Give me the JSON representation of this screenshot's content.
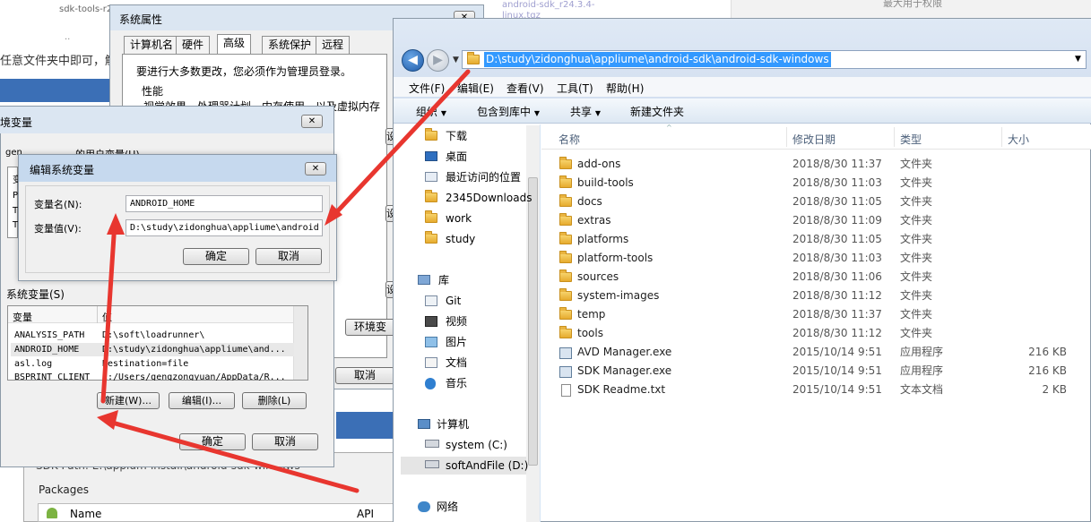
{
  "background": {
    "top_link_left": "sdk-tools-r24",
    "top_link_center": "android-sdk_r24.3.4-linux.tgz",
    "left_snippet": "任意文件夹中即可，解",
    "ellipsis": "..",
    "right_top_text": "最大用于权限",
    "sdk_path_label": "SDK Path: E:\\appium-install\\android-sdk-windows",
    "packages_label": "Packages",
    "col_name": "Name",
    "col_api": "API"
  },
  "system_properties": {
    "title": "系统属性",
    "tabs": [
      "计算机名",
      "硬件",
      "高级",
      "系统保护",
      "远程"
    ],
    "active_tab": "高级",
    "admin_note": "要进行大多数更改，您必须作为管理员登录。",
    "perf_group": "性能",
    "perf_desc": "视觉效果，处理器计划，内存使用，以及虚拟内存",
    "settings_btn": "设",
    "env_btn": "环境变",
    "cancel_btn": "取消"
  },
  "env_vars": {
    "title": "环境变量",
    "user_label_prefix": "gen",
    "user_label": "的用户变量(U)",
    "sys_label": "系统变量(S)",
    "col_var": "变量",
    "col_value": "值",
    "rows": [
      {
        "name": "ANALYSIS_PATH",
        "value": "D:\\soft\\loadrunner\\"
      },
      {
        "name": "ANDROID_HOME",
        "value": "D:\\study\\zidonghua\\appliume\\and..."
      },
      {
        "name": "asl.log",
        "value": "Destination=file"
      },
      {
        "name": "BSPRINT_CLIENT",
        "value": "C:/Users/gengzongyuan/AppData/R..."
      }
    ],
    "new_btn": "新建(W)...",
    "edit_btn": "编辑(I)...",
    "delete_btn": "删除(L)",
    "ok_btn": "确定",
    "cancel_btn": "取消",
    "user_list_initials": [
      "P",
      "T",
      "T"
    ],
    "user_list_header": "变"
  },
  "edit_var": {
    "title": "编辑系统变量",
    "name_label": "变量名(N):",
    "name_value": "ANDROID_HOME",
    "value_label": "变量值(V):",
    "value_value": "D:\\study\\zidonghua\\appliume\\android",
    "ok_btn": "确定",
    "cancel_btn": "取消"
  },
  "explorer": {
    "address": "D:\\study\\zidonghua\\appliume\\android-sdk\\android-sdk-windows",
    "menu": [
      "文件(F)",
      "编辑(E)",
      "查看(V)",
      "工具(T)",
      "帮助(H)"
    ],
    "toolbar": [
      "组织",
      "包含到库中",
      "共享",
      "新建文件夹"
    ],
    "columns": {
      "name": "名称",
      "date": "修改日期",
      "type": "类型",
      "size": "大小"
    },
    "nav": [
      {
        "label": "下载",
        "icon": "download-folder-icon"
      },
      {
        "label": "桌面",
        "icon": "desktop-icon"
      },
      {
        "label": "最近访问的位置",
        "icon": "recent-places-icon"
      },
      {
        "label": "2345Downloads",
        "icon": "folder-icon"
      },
      {
        "label": "work",
        "icon": "folder-icon"
      },
      {
        "label": "study",
        "icon": "folder-icon"
      },
      {
        "label": "库",
        "icon": "library-icon"
      },
      {
        "label": "Git",
        "icon": "git-library-icon"
      },
      {
        "label": "视频",
        "icon": "video-library-icon"
      },
      {
        "label": "图片",
        "icon": "picture-library-icon"
      },
      {
        "label": "文档",
        "icon": "document-library-icon"
      },
      {
        "label": "音乐",
        "icon": "music-library-icon"
      },
      {
        "label": "计算机",
        "icon": "computer-icon"
      },
      {
        "label": "system (C:)",
        "icon": "drive-icon"
      },
      {
        "label": "softAndFile (D:)",
        "icon": "drive-icon"
      },
      {
        "label": "网络",
        "icon": "network-icon"
      }
    ],
    "files": [
      {
        "name": "add-ons",
        "date": "2018/8/30 11:37",
        "type": "文件夹",
        "size": "",
        "kind": "folder"
      },
      {
        "name": "build-tools",
        "date": "2018/8/30 11:03",
        "type": "文件夹",
        "size": "",
        "kind": "folder"
      },
      {
        "name": "docs",
        "date": "2018/8/30 11:05",
        "type": "文件夹",
        "size": "",
        "kind": "folder"
      },
      {
        "name": "extras",
        "date": "2018/8/30 11:09",
        "type": "文件夹",
        "size": "",
        "kind": "folder"
      },
      {
        "name": "platforms",
        "date": "2018/8/30 11:05",
        "type": "文件夹",
        "size": "",
        "kind": "folder"
      },
      {
        "name": "platform-tools",
        "date": "2018/8/30 11:03",
        "type": "文件夹",
        "size": "",
        "kind": "folder"
      },
      {
        "name": "sources",
        "date": "2018/8/30 11:06",
        "type": "文件夹",
        "size": "",
        "kind": "folder"
      },
      {
        "name": "system-images",
        "date": "2018/8/30 11:12",
        "type": "文件夹",
        "size": "",
        "kind": "folder"
      },
      {
        "name": "temp",
        "date": "2018/8/30 11:37",
        "type": "文件夹",
        "size": "",
        "kind": "folder"
      },
      {
        "name": "tools",
        "date": "2018/8/30 11:12",
        "type": "文件夹",
        "size": "",
        "kind": "folder"
      },
      {
        "name": "AVD Manager.exe",
        "date": "2015/10/14 9:51",
        "type": "应用程序",
        "size": "216 KB",
        "kind": "exe"
      },
      {
        "name": "SDK Manager.exe",
        "date": "2015/10/14 9:51",
        "type": "应用程序",
        "size": "216 KB",
        "kind": "exe"
      },
      {
        "name": "SDK Readme.txt",
        "date": "2015/10/14 9:51",
        "type": "文本文档",
        "size": "2 KB",
        "kind": "txt"
      }
    ]
  },
  "colors": {
    "arrow": "#e8362f",
    "title_bar": "#c6d9ee",
    "address_highlight": "#3399ff"
  }
}
